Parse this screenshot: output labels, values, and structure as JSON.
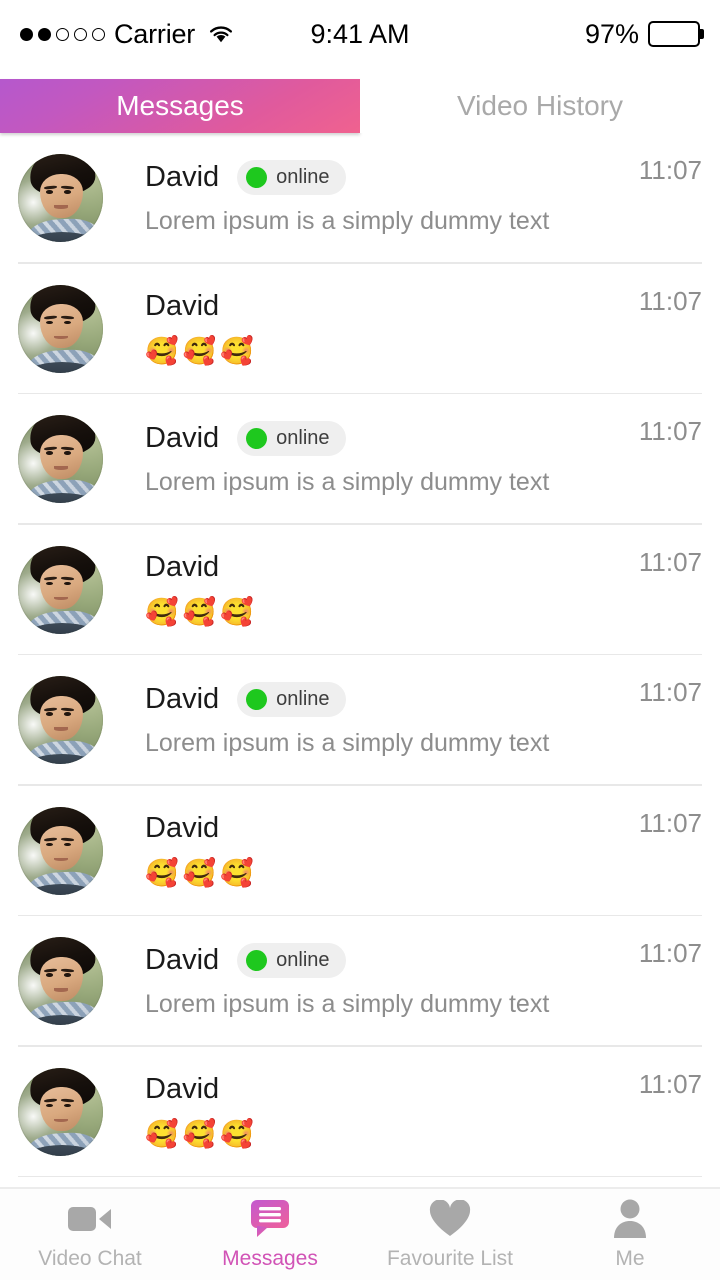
{
  "status_bar": {
    "signal_dots_total": 5,
    "signal_dots_filled": 2,
    "carrier": "Carrier",
    "wifi_icon": "wifi-icon",
    "time": "9:41 AM",
    "battery_percent": "97%",
    "battery_level": 97
  },
  "tabs": [
    {
      "label": "Messages",
      "active": true
    },
    {
      "label": "Video History",
      "active": false
    }
  ],
  "theme": {
    "accent_start": "#b558cd",
    "accent_end": "#f0628f",
    "online_green": "#1ec81e",
    "muted_text": "#8d8d8d",
    "nav_inactive": "#b3b3b3",
    "nav_active": "#d153b6",
    "divider": "#e8e8e8"
  },
  "conversations": [
    {
      "name": "David",
      "status": "online",
      "has_status": true,
      "preview": "Lorem ipsum is a simply dummy text",
      "is_emoji": false,
      "time": "11:07"
    },
    {
      "name": "David",
      "status": "",
      "has_status": false,
      "preview": "🥰🥰🥰",
      "is_emoji": true,
      "time": "11:07"
    },
    {
      "name": "David",
      "status": "online",
      "has_status": true,
      "preview": "Lorem ipsum is a simply dummy text",
      "is_emoji": false,
      "time": "11:07"
    },
    {
      "name": "David",
      "status": "",
      "has_status": false,
      "preview": "🥰🥰🥰",
      "is_emoji": true,
      "time": "11:07"
    },
    {
      "name": "David",
      "status": "online",
      "has_status": true,
      "preview": "Lorem ipsum is a simply dummy text",
      "is_emoji": false,
      "time": "11:07"
    },
    {
      "name": "David",
      "status": "",
      "has_status": false,
      "preview": "🥰🥰🥰",
      "is_emoji": true,
      "time": "11:07"
    },
    {
      "name": "David",
      "status": "online",
      "has_status": true,
      "preview": "Lorem ipsum is a simply dummy text",
      "is_emoji": false,
      "time": "11:07"
    },
    {
      "name": "David",
      "status": "",
      "has_status": false,
      "preview": "🥰🥰🥰",
      "is_emoji": true,
      "time": "11:07"
    }
  ],
  "bottom_nav": [
    {
      "label": "Video Chat",
      "icon": "video-camera-icon",
      "active": false
    },
    {
      "label": "Messages",
      "icon": "chat-bubble-icon",
      "active": true
    },
    {
      "label": "Favourite List",
      "icon": "heart-icon",
      "active": false
    },
    {
      "label": "Me",
      "icon": "person-icon",
      "active": false
    }
  ]
}
